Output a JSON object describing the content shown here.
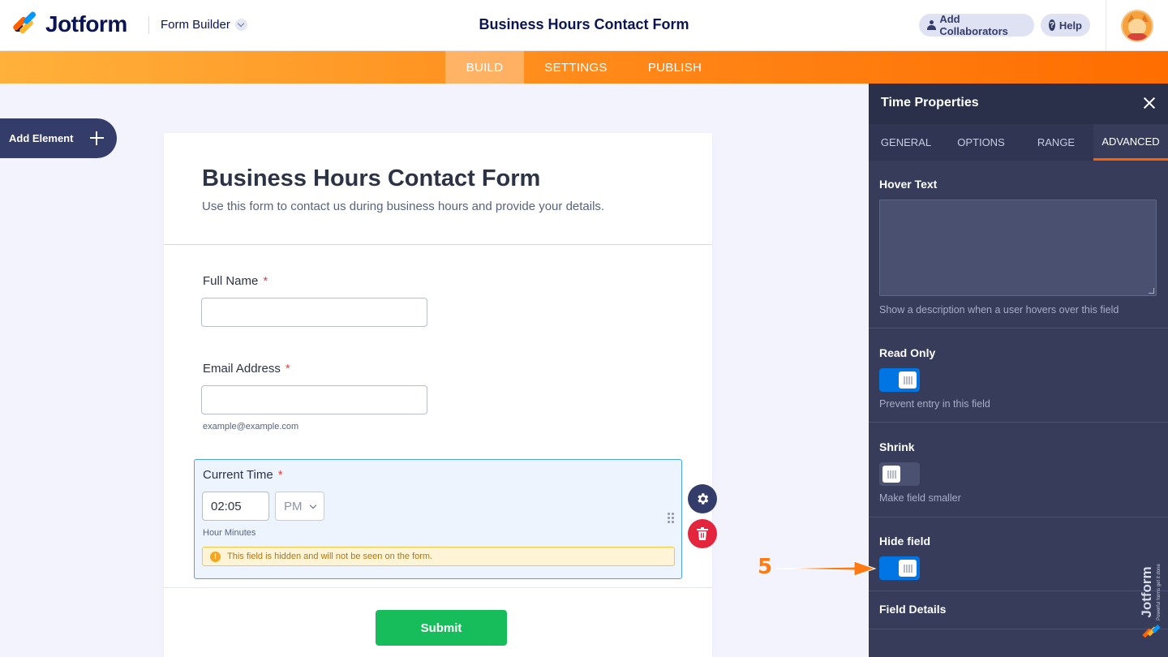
{
  "header": {
    "brand": "Jotform",
    "builder_label": "Form Builder",
    "title": "Business Hours Contact Form",
    "add_collaborators": "Add Collaborators",
    "help": "Help"
  },
  "nav": {
    "build": "BUILD",
    "settings": "SETTINGS",
    "publish": "PUBLISH"
  },
  "sidebar": {
    "add_element": "Add Element"
  },
  "form": {
    "heading": "Business Hours Contact Form",
    "subheading": "Use this form to contact us during business hours and provide your details.",
    "full_name": {
      "label": "Full Name",
      "required": "*",
      "value": ""
    },
    "email": {
      "label": "Email Address",
      "required": "*",
      "value": "",
      "sublabel": "example@example.com"
    },
    "time": {
      "label": "Current Time",
      "required": "*",
      "hour_minutes": "02:05",
      "ampm": "PM",
      "sublabel": "Hour Minutes",
      "warning": "This field is hidden and will not be seen on the form."
    },
    "submit": "Submit"
  },
  "panel": {
    "title": "Time Properties",
    "tabs": [
      "GENERAL",
      "OPTIONS",
      "RANGE",
      "ADVANCED"
    ],
    "active_tab": "ADVANCED",
    "hover_text": {
      "label": "Hover Text",
      "value": "",
      "help": "Show a description when a user hovers over this field"
    },
    "read_only": {
      "label": "Read Only",
      "on": true,
      "help": "Prevent entry in this field"
    },
    "shrink": {
      "label": "Shrink",
      "on": false,
      "help": "Make field smaller"
    },
    "hide_field": {
      "label": "Hide field",
      "on": true
    },
    "field_details": {
      "label": "Field Details"
    }
  },
  "annotation": {
    "step": "5",
    "color": "#ff7a12"
  },
  "watermark": {
    "brand": "Jotform",
    "tagline": "Powerful forms get it done"
  },
  "colors": {
    "accent": "#ff6100",
    "toggle_on": "#0075e3",
    "submit": "#18bd5b",
    "panel_bg": "#363c5a"
  }
}
